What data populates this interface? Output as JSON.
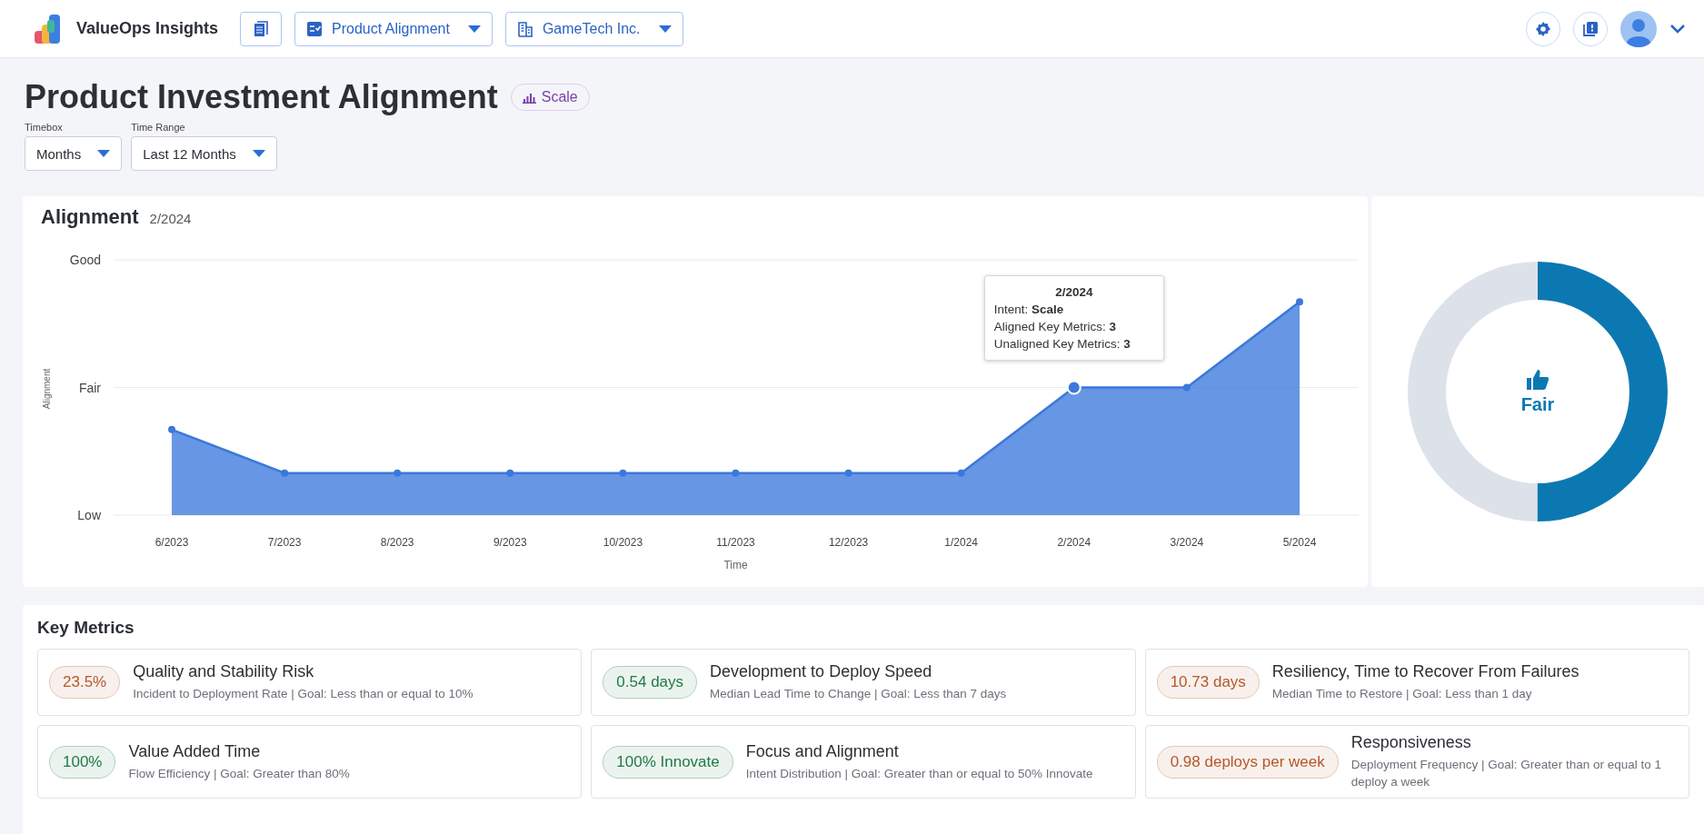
{
  "header": {
    "app_name": "ValueOps Insights",
    "selectors": [
      {
        "label": "Product Alignment",
        "kind": "checklist"
      },
      {
        "label": "GameTech Inc.",
        "kind": "building"
      }
    ]
  },
  "page": {
    "title": "Product Investment Alignment",
    "badge": "Scale",
    "filters": [
      {
        "label": "Timebox",
        "value": "Months"
      },
      {
        "label": "Time Range",
        "value": "Last 12 Months"
      }
    ]
  },
  "alignment": {
    "title": "Alignment",
    "period": "2/2024",
    "chart": {
      "y_labels": [
        "Good",
        "Fair",
        "Low"
      ],
      "ylabel": "Alignment",
      "x_labels": [
        "6/2023",
        "7/2023",
        "8/2023",
        "9/2023",
        "10/2023",
        "11/2023",
        "12/2023",
        "1/2024",
        "2/2024",
        "3/2024",
        "5/2024"
      ],
      "xlabel": "Time"
    },
    "tooltip": {
      "title": "2/2024",
      "lines": [
        "Intent: **Scale**",
        "Aligned Key Metrics: **3**",
        "Unaligned Key Metrics: **3**"
      ]
    },
    "gauge": {
      "label": "Fair",
      "level": 0.5
    }
  },
  "key_metrics": {
    "title": "Key Metrics",
    "items": [
      {
        "value": "23.5%",
        "color": "#b4582a",
        "name": "Quality and Stability Risk",
        "detail": "Incident to Deployment Rate | Goal: Less than or equal to 10%"
      },
      {
        "value": "0.54 days",
        "color": "#1f7a47",
        "name": "Development to Deploy Speed",
        "detail": "Median Lead Time to Change | Goal: Less than 7 days"
      },
      {
        "value": "10.73 days",
        "color": "#b4582a",
        "name": "Resiliency, Time to Recover From Failures",
        "detail": "Median Time to Restore | Goal: Less than 1 day"
      },
      {
        "value": "100%",
        "color": "#1f7a47",
        "name": "Value Added Time",
        "detail": "Flow Efficiency | Goal: Greater than 80%"
      },
      {
        "value": "100% Innovate",
        "color": "#1f7a47",
        "name": "Focus and Alignment",
        "detail": "Intent Distribution | Goal: Greater than or equal to 50% Innovate"
      },
      {
        "value": "0.98 deploys per week",
        "color": "#b4582a",
        "name": "Responsiveness",
        "detail": "Deployment Frequency | Goal: Greater than or equal to 1 deploy a week"
      }
    ]
  }
}
